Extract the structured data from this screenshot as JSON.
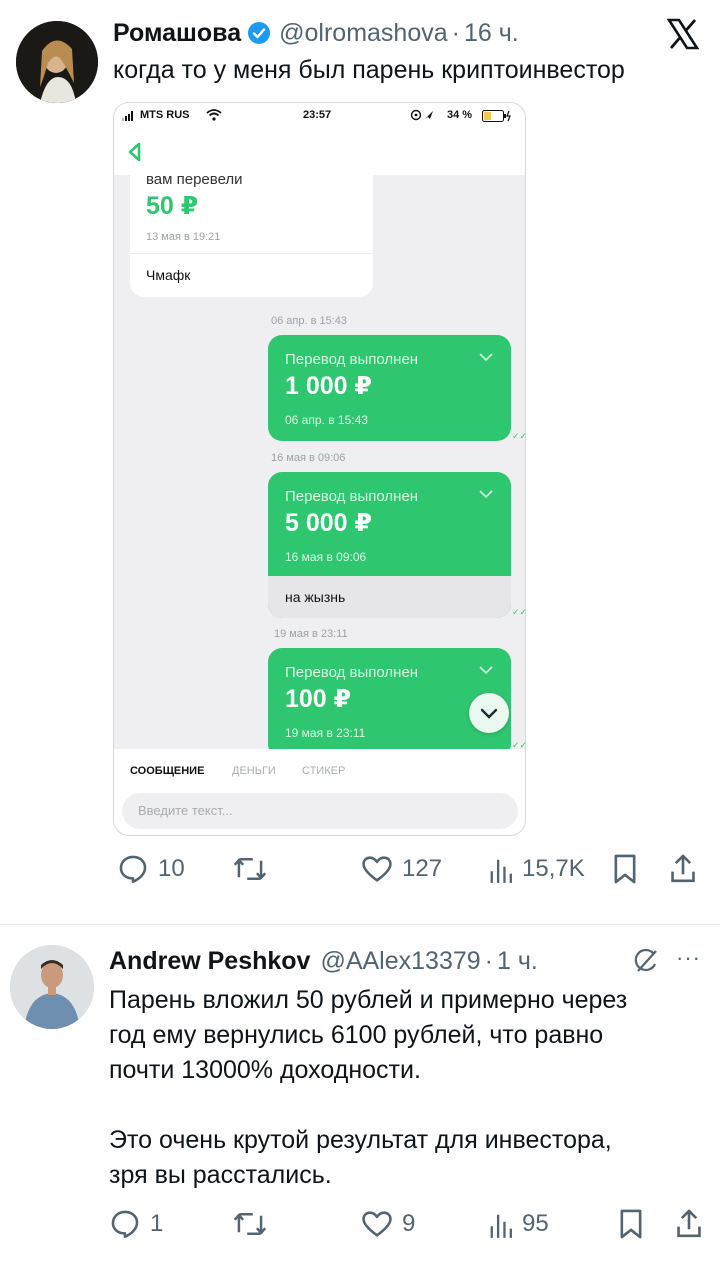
{
  "tweet1": {
    "name": "Ромашова",
    "handle": "@olromashova",
    "dot": "·",
    "time": "16 ч.",
    "text": "когда то у меня был парень криптоинвестор",
    "logo_icon": "x-logo-icon",
    "actions": {
      "replies": "10",
      "likes": "127",
      "views": "15,7K"
    }
  },
  "media": {
    "status_bar": {
      "carrier": "MTS RUS",
      "time": "23:57",
      "battery": "34 %"
    },
    "incoming": {
      "title": "вам перевели",
      "amount": "50 ₽",
      "time": "13 мая в 19:21",
      "sender": "Чмафк"
    },
    "transfers": [
      {
        "date": "06 апр. в 15:43",
        "status": "Перевод выполнен",
        "amount": "1 000 ₽",
        "time": "06 апр. в 15:43",
        "note": ""
      },
      {
        "date": "16 мая в 09:06",
        "status": "Перевод выполнен",
        "amount": "5 000 ₽",
        "time": "16 мая в 09:06",
        "note": "на жызнь"
      },
      {
        "date": "19 мая в 23:11",
        "status": "Перевод выполнен",
        "amount": "100 ₽",
        "time": "19 мая в 23:11",
        "note": ""
      }
    ],
    "composer": {
      "tabs": [
        "СООБЩЕНИЕ",
        "ДЕНЬГИ",
        "СТИКЕР"
      ],
      "placeholder": "Введите текст..."
    },
    "colors": {
      "green": "#2ec76f",
      "chat_bg": "#efeff2"
    }
  },
  "tweet2": {
    "name": "Andrew Peshkov",
    "handle": "@AAlex13379",
    "dot": "·",
    "time": "1 ч.",
    "more": "···",
    "text_line1": "Парень вложил 50 рублей и примерно через",
    "text_line2": "год ему вернулись 6100 рублей, что равно",
    "text_line3": "почти 13000% доходности.",
    "text_line4": "Это очень крутой результат для инвестора,",
    "text_line5": "зря вы расстались.",
    "actions": {
      "replies": "1",
      "likes": "9",
      "views": "95"
    }
  },
  "colors": {
    "text": "#0f1419",
    "muted": "#536471",
    "verified": "#1d9bf0"
  }
}
